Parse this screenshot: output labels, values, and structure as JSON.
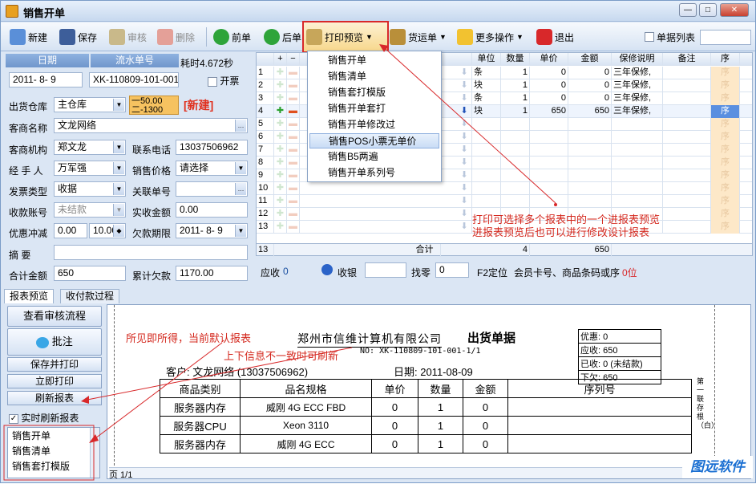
{
  "window": {
    "title": "销售开单",
    "buttons": [
      "—",
      "□",
      "✕"
    ]
  },
  "toolbar": {
    "new": "新建",
    "save": "保存",
    "review": "审核",
    "delete": "删除",
    "prev": "前单",
    "next": "后单",
    "print_preview": "打印预览",
    "shipping": "货运单",
    "more": "更多操作",
    "exit": "退出",
    "list_label": "单据列表"
  },
  "form": {
    "date_header": "日期",
    "serial_header": "流水单号",
    "elapsed": "耗时4.672秒",
    "date": "2011- 8- 9",
    "serial": "XK-110809-101-001",
    "invoice_label": "开票",
    "warehouse_label": "出货仓库",
    "warehouse": "主仓库",
    "badge_a": "一50.00",
    "badge_b": "二-1300",
    "status": "[新建]",
    "customer_label": "客商名称",
    "customer": "文龙网络",
    "org_label": "客商机构",
    "org": "郑文龙",
    "phone_label": "联系电话",
    "phone": "13037506962",
    "handler_label": "经 手 人",
    "handler": "万军强",
    "price_label": "销售价格",
    "price": "请选择",
    "invoice_type_label": "发票类型",
    "invoice_type": "收据",
    "related_label": "关联单号",
    "related": "",
    "account_label": "收款账号",
    "account": "未结款",
    "paid_label": "实收金额",
    "paid": "0.00",
    "discount_label": "优惠冲减",
    "discount_a": "0.00",
    "discount_b": "10.00",
    "due_label": "欠款期限",
    "due": "2011- 8- 9",
    "memo_label": "摘 要",
    "memo": "",
    "total_label": "合计金额",
    "total": "650",
    "debt_label": "累计欠款",
    "debt": "1170.00"
  },
  "grid": {
    "headers": [
      "+",
      "−",
      "单位",
      "数量",
      "单价",
      "金额",
      "保修说明",
      "备注",
      "序"
    ],
    "rows": [
      {
        "n": "1",
        "unit": "条",
        "qty": "1",
        "price": "0",
        "amount": "0",
        "warranty": "三年保修,"
      },
      {
        "n": "2",
        "unit": "块",
        "qty": "1",
        "price": "0",
        "amount": "0",
        "warranty": "三年保修,"
      },
      {
        "n": "3",
        "unit": "条",
        "qty": "1",
        "price": "0",
        "amount": "0",
        "warranty": "三年保修,"
      },
      {
        "n": "4",
        "unit": "块",
        "qty": "1",
        "price": "650",
        "amount": "650",
        "warranty": "三年保修,"
      },
      {
        "n": "5"
      },
      {
        "n": "6"
      },
      {
        "n": "7"
      },
      {
        "n": "8"
      },
      {
        "n": "9"
      },
      {
        "n": "10"
      },
      {
        "n": "11"
      },
      {
        "n": "12"
      },
      {
        "n": "13"
      }
    ],
    "seq_label": "序",
    "total_count": "13",
    "total_label": "合计",
    "total_qty": "4",
    "total_amount": "650"
  },
  "paybar": {
    "receivable_label": "应收",
    "receivable": "0",
    "cashier": "收银",
    "change_label": "找零",
    "change": "0",
    "locate": "F2定位",
    "locate_hint": "会员卡号、商品条码或序",
    "locate_flag": "0位"
  },
  "print_menu": {
    "items": [
      "销售开单",
      "销售清单",
      "销售套打模版",
      "销售开单套打",
      "销售开单修改过",
      "销售POS小票无单价",
      "销售B5两遍",
      "销售开单系列号"
    ]
  },
  "tabs": [
    "报表预览",
    "收付款过程"
  ],
  "side": {
    "flow": "查看审核流程",
    "comment": "批注",
    "save_print": "保存并打印",
    "print_now": "立即打印",
    "refresh": "刷新报表",
    "realtime": "实时刷新报表",
    "reports": [
      "销售开单",
      "销售清单",
      "销售套打模版"
    ]
  },
  "preview": {
    "company": "郑州市信维计算机有限公司",
    "doc_title": "出货单据",
    "no": "NO: XK-110809-101-001-1/1",
    "customer": "客户: 文龙网络 (13037506962)",
    "date": "日期: 2011-08-09",
    "summary": [
      "优惠: 0",
      "应收: 650",
      "已收: 0 (未结款)",
      "下欠: 650"
    ],
    "headers": [
      "商品类别",
      "品名规格",
      "单价",
      "数量",
      "金额",
      "序列号"
    ],
    "rows": [
      [
        "服务器内存",
        "威刚 4G ECC FBD",
        "0",
        "1",
        "0",
        ""
      ],
      [
        "服务器CPU",
        "Xeon 3110",
        "0",
        "1",
        "0",
        ""
      ],
      [
        "服务器内存",
        "威刚 4G ECC",
        "0",
        "1",
        "0",
        ""
      ]
    ],
    "side_note": "第一联存根（白）",
    "page": "页 1/1"
  },
  "annotations": {
    "a1": "打印可选择多个报表中的一个进报表预览",
    "a2": "进报表预览后也可以进行修改设计报表",
    "a3": "所见即所得，当前默认报表",
    "a4": "上下信息不一致时可刷新"
  },
  "logo": "图远软件"
}
